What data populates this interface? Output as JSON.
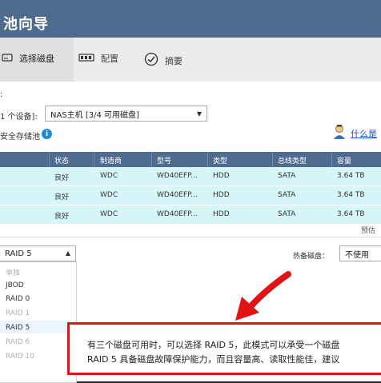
{
  "window": {
    "title": "池向导"
  },
  "steps": [
    {
      "label": "选择磁盘",
      "icon": "disk-icon",
      "active": true
    },
    {
      "label": "配置",
      "icon": "config-icon",
      "active": false
    },
    {
      "label": "摘要",
      "icon": "check-circle-icon",
      "active": false
    }
  ],
  "form": {
    "select_label": "1 个设备]:",
    "device_value": "NAS主机 [3/4 可用磁盘]",
    "secure_label": "安全存储池",
    "help_link": "什么是"
  },
  "table": {
    "headers": [
      "状态",
      "制造商",
      "型号",
      "类型",
      "总线类型",
      "容量"
    ],
    "rows": [
      [
        "良好",
        "WDC",
        "WD40EFP...",
        "HDD",
        "SATA",
        "3.64 TB"
      ],
      [
        "良好",
        "WDC",
        "WD40EFP...",
        "HDD",
        "SATA",
        "3.64 TB"
      ],
      [
        "良好",
        "WDC",
        "WD40EFP...",
        "HDD",
        "SATA",
        "3.64 TB"
      ]
    ],
    "footer_note": "预估"
  },
  "raid": {
    "selected": "RAID 5",
    "options": [
      {
        "label": "单独",
        "enabled": false
      },
      {
        "label": "JBOD",
        "enabled": true
      },
      {
        "label": "RAID 0",
        "enabled": true
      },
      {
        "label": "RAID 1",
        "enabled": false
      },
      {
        "label": "RAID 5",
        "enabled": true
      },
      {
        "label": "RAID 6",
        "enabled": false
      },
      {
        "label": "RAID 10",
        "enabled": false
      }
    ]
  },
  "spare": {
    "label": "热备磁盘：",
    "value": "不使用"
  },
  "callout": {
    "line1": "有三个磁盘可用时，可以选择 RAID 5，此模式可以承受一个磁盘",
    "line2": "RAID 5 具备磁盘故障保护能力，而且容量高、读取性能佳，建议"
  },
  "colors": {
    "header": "#4e6a8c",
    "row": "#d7f6f8",
    "annotation": "#e01414"
  }
}
